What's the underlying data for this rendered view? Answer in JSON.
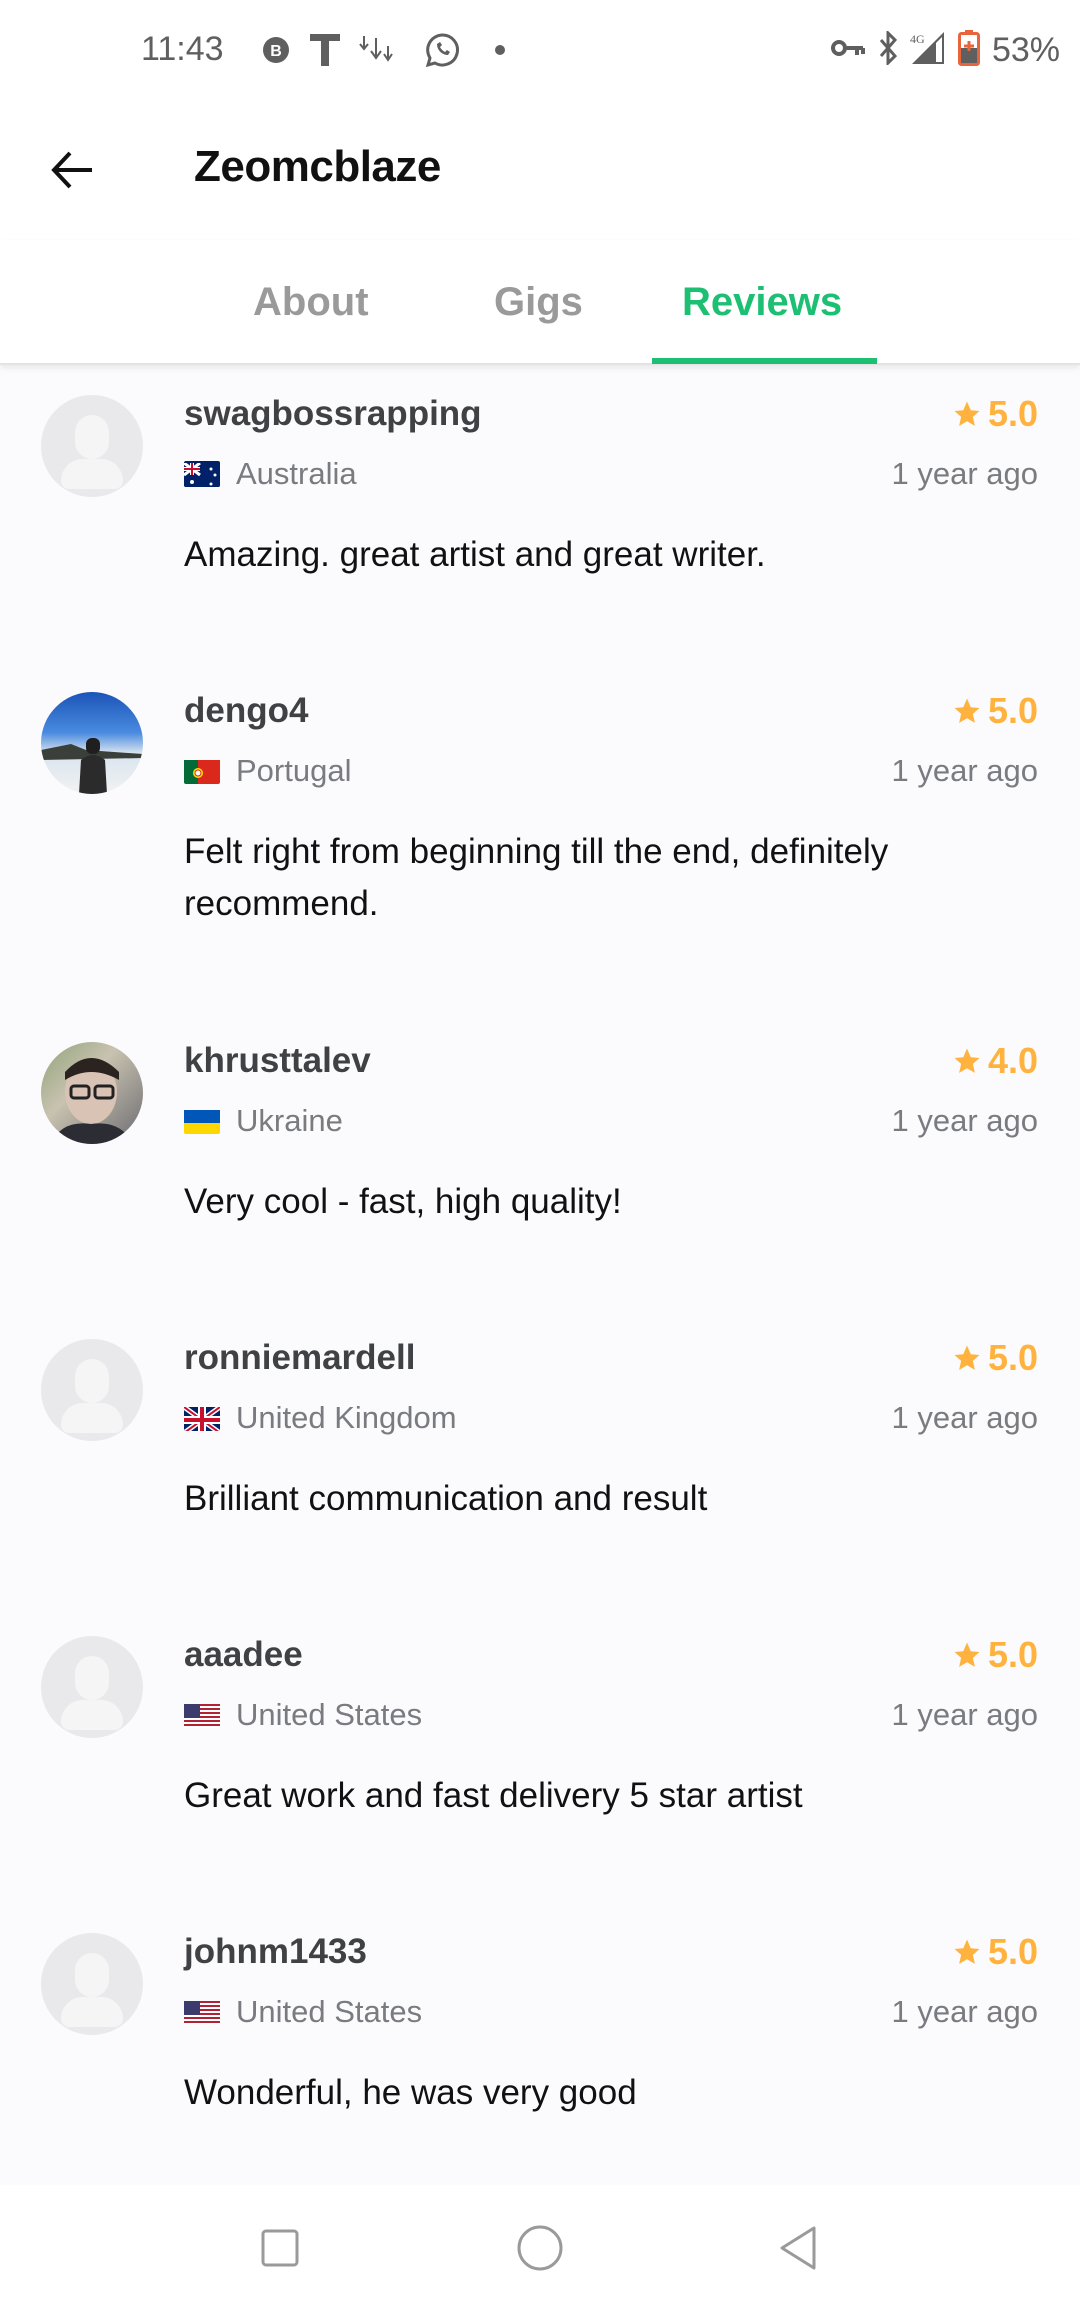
{
  "status_bar": {
    "time": "11:43",
    "left_icons": [
      "b-circle-icon",
      "t-icon",
      "download-arrows-icon",
      "whatsapp-icon",
      "dot-icon"
    ],
    "right_icons": [
      "vpn-key-icon",
      "bluetooth-icon",
      "signal-4g-icon",
      "battery-charging-icon"
    ],
    "signal_label": "4G",
    "battery_percent": "53%"
  },
  "app_bar": {
    "title": "Zeomcblaze",
    "back_icon": "arrow-left-icon"
  },
  "tabs": [
    {
      "label": "About",
      "active": false
    },
    {
      "label": "Gigs",
      "active": false
    },
    {
      "label": "Reviews",
      "active": true
    }
  ],
  "colors": {
    "accent": "#1dbf73",
    "star": "#ffb33e",
    "text_primary": "#404145",
    "text_secondary": "#7a7b80"
  },
  "reviews": [
    {
      "username": "swagbossrapping",
      "rating": "5.0",
      "country": "Australia",
      "flag": "AU",
      "time_ago": "1 year ago",
      "comment": "Amazing. great artist and great writer.",
      "avatar": "placeholder"
    },
    {
      "username": "dengo4",
      "rating": "5.0",
      "country": "Portugal",
      "flag": "PT",
      "time_ago": "1 year ago",
      "comment": "Felt right from beginning till the end, definitely recommend.",
      "avatar": "photo-sky"
    },
    {
      "username": "khrusttalev",
      "rating": "4.0",
      "country": "Ukraine",
      "flag": "UA",
      "time_ago": "1 year ago",
      "comment": "Very cool - fast, high quality!",
      "avatar": "photo-person"
    },
    {
      "username": "ronniemardell",
      "rating": "5.0",
      "country": "United Kingdom",
      "flag": "GB",
      "time_ago": "1 year ago",
      "comment": "Brilliant communication and result",
      "avatar": "placeholder"
    },
    {
      "username": "aaadee",
      "rating": "5.0",
      "country": "United States",
      "flag": "US",
      "time_ago": "1 year ago",
      "comment": "Great work and fast delivery 5 star artist",
      "avatar": "placeholder"
    },
    {
      "username": "johnm1433",
      "rating": "5.0",
      "country": "United States",
      "flag": "US",
      "time_ago": "1 year ago",
      "comment": "Wonderful, he was very good",
      "avatar": "placeholder"
    }
  ],
  "nav_bar": {
    "buttons": [
      "recents-square-icon",
      "home-circle-icon",
      "back-triangle-icon"
    ]
  }
}
